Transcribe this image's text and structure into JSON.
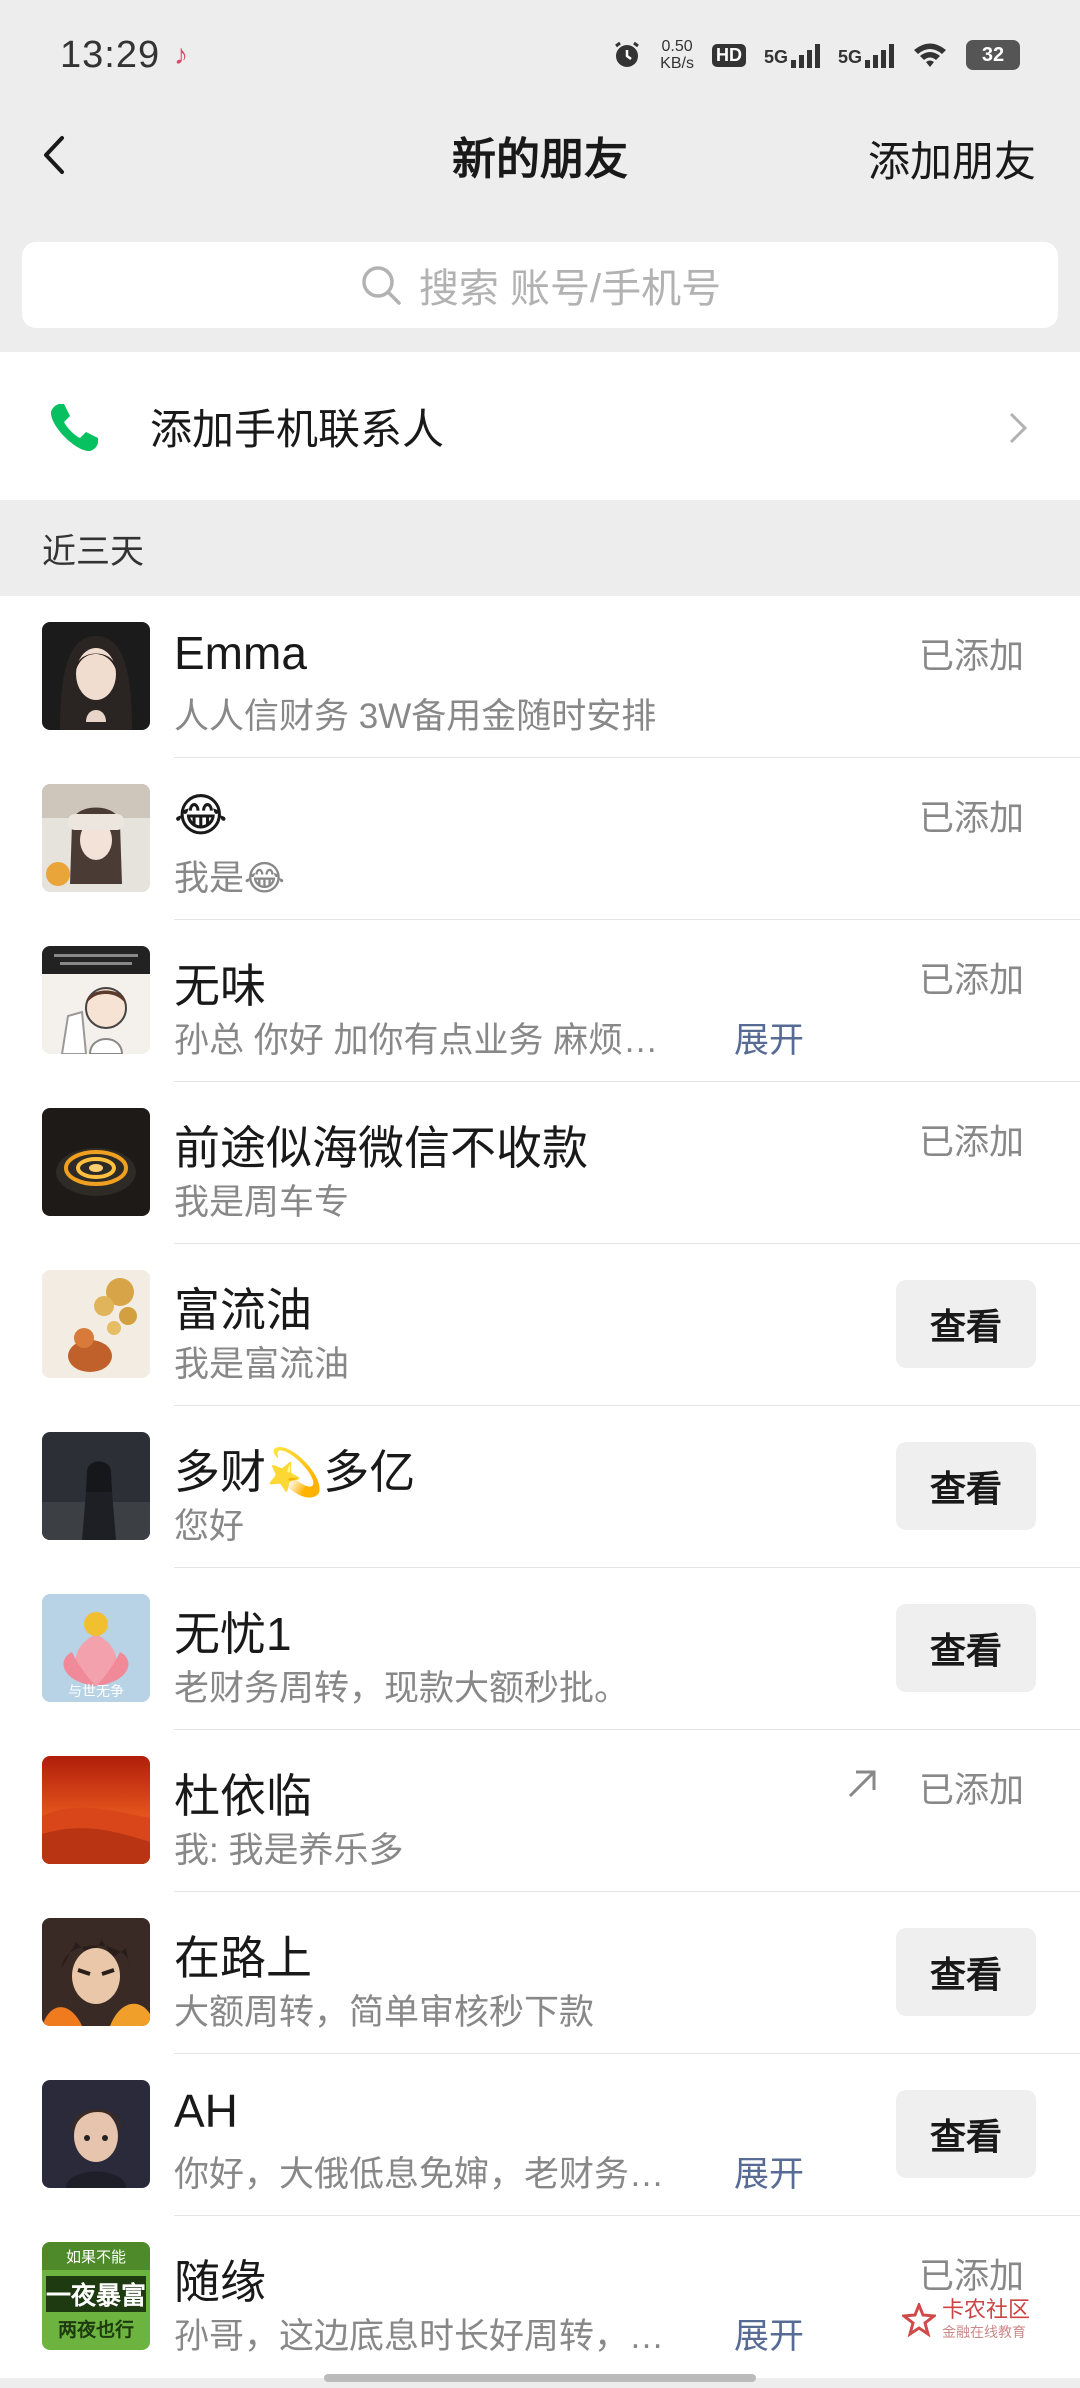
{
  "status_bar": {
    "time": "13:29",
    "speed_value": "0.50",
    "speed_unit": "KB/s",
    "hd": "HD",
    "net1": "5G",
    "net2": "5G",
    "battery": "32"
  },
  "nav": {
    "title": "新的朋友",
    "add_label": "添加朋友"
  },
  "search": {
    "placeholder": "搜索 账号/手机号"
  },
  "phone_contacts": {
    "label": "添加手机联系人"
  },
  "section": {
    "label": "近三天"
  },
  "colors": {
    "accent_green": "#07c160",
    "link_blue": "#576b95"
  },
  "requests": [
    {
      "name": "Emma",
      "message": "人人信财务 3W备用金随时安排",
      "status": "已添加"
    },
    {
      "name": "😂",
      "message": "我是😂",
      "status": "已添加"
    },
    {
      "name": "无味",
      "message": "孙总 你好 加你有点业务 麻烦…",
      "expand": "展开",
      "status": "已添加"
    },
    {
      "name": "前途似海微信不收款",
      "message": "我是周车专",
      "status": "已添加"
    },
    {
      "name": "富流油",
      "message": "我是富流油",
      "action": "查看"
    },
    {
      "name": "多财💫多亿",
      "message": "您好",
      "action": "查看"
    },
    {
      "name": "无忧1",
      "message": "老财务周转，现款大额秒批。",
      "action": "查看"
    },
    {
      "name": "杜依临",
      "message": "我: 我是养乐多",
      "status": "已添加",
      "icon": "outgoing-arrow-icon"
    },
    {
      "name": "在路上",
      "message": "大额周转，简单审核秒下款",
      "action": "查看"
    },
    {
      "name": "AH",
      "message": "你好，大俄低息免婶，老财务…",
      "expand": "展开",
      "action": "查看"
    },
    {
      "name": "随缘",
      "message": "孙哥，这边底息时长好周转，…",
      "expand": "展开",
      "status": "已添加"
    }
  ],
  "avatar_texts": {
    "row11": [
      "如果不能",
      "一夜暴富",
      "两夜也行"
    ],
    "row7": "与世无争"
  },
  "watermark": {
    "name": "卡农社区",
    "sub": "金融在线教育"
  }
}
